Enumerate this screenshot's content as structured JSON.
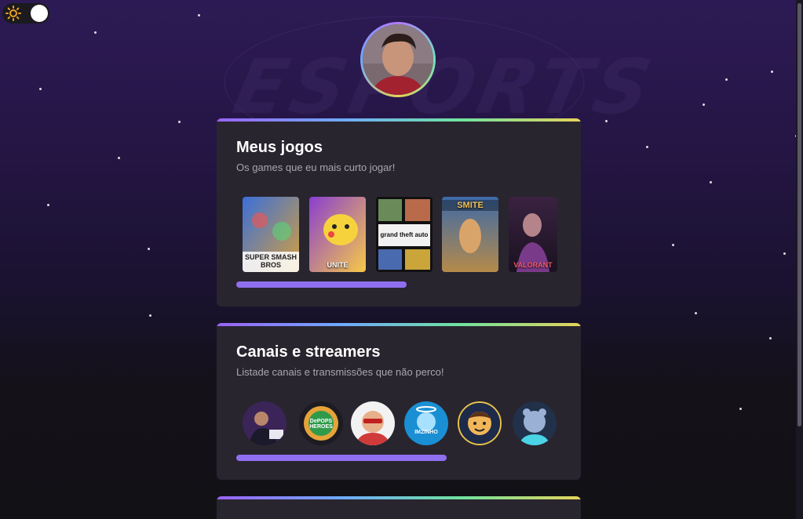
{
  "theme_toggle": {
    "icon": "sun-icon",
    "state": "light-knob-right"
  },
  "background": {
    "watermark_text": "ESPORTS"
  },
  "profile": {
    "avatar": "profile-avatar"
  },
  "sections": [
    {
      "title": "Meus jogos",
      "subtitle": "Os games que eu mais curto jogar!",
      "scroll_progress": 0.5,
      "items": [
        {
          "name": "Super Smash Bros. Ultimate",
          "label": "SUPER SMASH BROS",
          "color_a": "#3a6fd8",
          "color_b": "#d6a03d"
        },
        {
          "name": "Pokémon Unite",
          "label": "UNITE",
          "color_a": "#8a3fd0",
          "color_b": "#f7c948"
        },
        {
          "name": "Grand Theft Auto V",
          "label": "grand theft auto",
          "color_a": "#2d2d2d",
          "color_b": "#6a8a5a"
        },
        {
          "name": "SMITE",
          "label": "SMITE",
          "color_a": "#b58a4a",
          "color_b": "#3d6aa8"
        },
        {
          "name": "VALORANT",
          "label": "VALORANT",
          "color_a": "#3a2240",
          "color_b": "#d6506b"
        }
      ]
    },
    {
      "title": "Canais e streamers",
      "subtitle": "Listade canais e transmissões que não perco!",
      "scroll_progress": 0.6,
      "items": [
        {
          "name": "streamer-1",
          "label": "",
          "color_a": "#3b2458",
          "color_b": "#7a5cc0"
        },
        {
          "name": "Depops Heroes",
          "label": "DePOPS HEROES",
          "color_a": "#e6a33a",
          "color_b": "#2f9a4a"
        },
        {
          "name": "streamer-3",
          "label": "",
          "color_a": "#f2f2f2",
          "color_b": "#d13a3a"
        },
        {
          "name": "imzinho",
          "label": "IMZINHO",
          "color_a": "#1a8fd4",
          "color_b": "#a8e0ff"
        },
        {
          "name": "streamer-5",
          "label": "",
          "color_a": "#1d2a4a",
          "color_b": "#f2b65a"
        },
        {
          "name": "streamer-6",
          "label": "",
          "color_a": "#22314a",
          "color_b": "#9ab0d4"
        }
      ]
    },
    {
      "title": "",
      "subtitle": "",
      "items": []
    }
  ],
  "colors": {
    "accent": "#8f6ff0",
    "card_bg": "#29252f",
    "subtitle": "#a9a5b2"
  }
}
